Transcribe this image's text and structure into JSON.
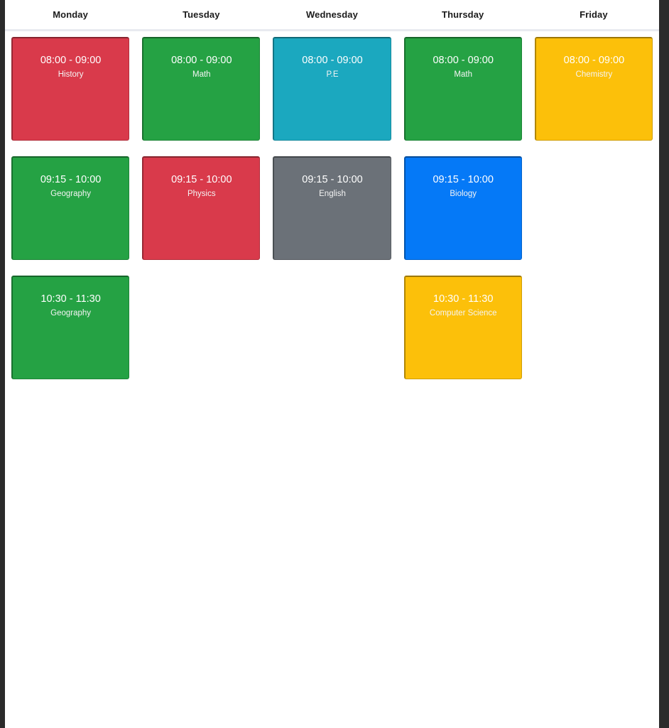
{
  "app": {
    "view_name": "weekly-timetable",
    "page_background": "#ffffff",
    "chrome_background": "#2b2b2b",
    "header_rule_color": "#e8eaf0"
  },
  "header": {
    "days": [
      {
        "label": "Monday"
      },
      {
        "label": "Tuesday"
      },
      {
        "label": "Wednesday"
      },
      {
        "label": "Thursday"
      },
      {
        "label": "Friday"
      }
    ]
  },
  "palette": {
    "history_red": "#d93a4b",
    "math_green": "#25a244",
    "pe_teal": "#1ba8bf",
    "chemistry_yellow": "#fcc00a",
    "geography_green": "#25a244",
    "physics_red": "#d93a4b",
    "english_grey": "#6b7178",
    "biology_blue": "#0579f7",
    "cs_yellow": "#fcc00a"
  },
  "time_rows": [
    {
      "label": "08:00 - 09:00"
    },
    {
      "label": "09:15 - 10:00"
    },
    {
      "label": "10:30 - 11:30"
    }
  ],
  "columns": [
    {
      "day": "Monday",
      "slots": [
        {
          "occupied": true,
          "time": "08:00 - 09:00",
          "subject": "History",
          "color": "#d93a4b"
        },
        {
          "occupied": true,
          "time": "09:15 - 10:00",
          "subject": "Geography",
          "color": "#25a244"
        },
        {
          "occupied": true,
          "time": "10:30 - 11:30",
          "subject": "Geography",
          "color": "#25a244"
        }
      ]
    },
    {
      "day": "Tuesday",
      "slots": [
        {
          "occupied": true,
          "time": "08:00 - 09:00",
          "subject": "Math",
          "color": "#25a244"
        },
        {
          "occupied": true,
          "time": "09:15 - 10:00",
          "subject": "Physics",
          "color": "#d93a4b"
        },
        {
          "occupied": false,
          "time": "",
          "subject": "",
          "color": ""
        }
      ]
    },
    {
      "day": "Wednesday",
      "slots": [
        {
          "occupied": true,
          "time": "08:00 - 09:00",
          "subject": "P.E",
          "color": "#1ba8bf"
        },
        {
          "occupied": true,
          "time": "09:15 - 10:00",
          "subject": "English",
          "color": "#6b7178"
        },
        {
          "occupied": false,
          "time": "",
          "subject": "",
          "color": ""
        }
      ]
    },
    {
      "day": "Thursday",
      "slots": [
        {
          "occupied": true,
          "time": "08:00 - 09:00",
          "subject": "Math",
          "color": "#25a244"
        },
        {
          "occupied": true,
          "time": "09:15 - 10:00",
          "subject": "Biology",
          "color": "#0579f7"
        },
        {
          "occupied": true,
          "time": "10:30 - 11:30",
          "subject": "Computer Science",
          "color": "#fcc00a"
        }
      ]
    },
    {
      "day": "Friday",
      "slots": [
        {
          "occupied": true,
          "time": "08:00 - 09:00",
          "subject": "Chemistry",
          "color": "#fcc00a"
        },
        {
          "occupied": false,
          "time": "",
          "subject": "",
          "color": ""
        },
        {
          "occupied": false,
          "time": "",
          "subject": "",
          "color": ""
        }
      ]
    }
  ]
}
